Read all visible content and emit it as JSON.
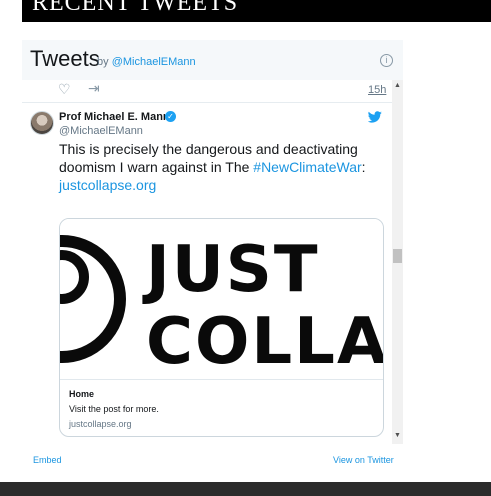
{
  "section": {
    "heading": "RECENT TWEETS"
  },
  "widget": {
    "title": "Tweets",
    "by_prefix": "by",
    "by_handle": "@MichaelEMann",
    "info_icon": "info-icon"
  },
  "previous_tweet": {
    "time": "15h",
    "icons": [
      "heart-icon",
      "share-icon"
    ]
  },
  "tweet": {
    "author_name": "Prof Michael E. Mann",
    "author_handle": "@MichaelEMann",
    "verified": true,
    "text_plain": "This is precisely the dangerous and deactivating doomism I warn against in The ",
    "hashtag": "#NewClimateWar",
    "text_after_hashtag": ":",
    "link_text": "justcollapse.org",
    "card": {
      "image_text": "JUST COLLAPSE",
      "title": "Home",
      "description": "Visit the post for more.",
      "domain": "justcollapse.org"
    }
  },
  "footer": {
    "embed": "Embed",
    "view_on_twitter": "View on Twitter"
  },
  "colors": {
    "link": "#1b95e0",
    "twitter_blue": "#1da1f2",
    "banner": "#000000",
    "widget_bg": "#f5f8fa",
    "footer_bar": "#2b2b2b"
  }
}
